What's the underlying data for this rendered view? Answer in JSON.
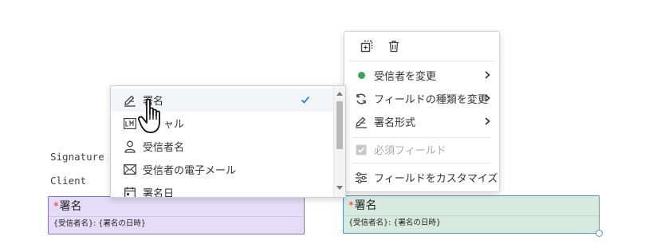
{
  "document": {
    "labels": [
      "Signature",
      "Client"
    ]
  },
  "fields": {
    "left": {
      "required_mark": "*",
      "title": "署名",
      "subtitle": "{受信者名}: {署名の日時}"
    },
    "right": {
      "required_mark": "*",
      "title": "署名",
      "subtitle": "{受信者名}: {署名の日時}"
    }
  },
  "context_menu": {
    "toolbar": [
      "copy-icon",
      "trash-icon"
    ],
    "items": [
      {
        "label": "受信者を変更",
        "icon": "green-dot-icon",
        "submenu": true,
        "disabled": false
      },
      {
        "label": "フィールドの種類を変更",
        "icon": "refresh-icon",
        "submenu": true,
        "disabled": false
      },
      {
        "label": "署名形式",
        "icon": "signature-icon",
        "submenu": true,
        "disabled": false
      },
      {
        "label": "必須フィールド",
        "icon": "checkbox-icon",
        "submenu": false,
        "disabled": true
      },
      {
        "label": "フィールドをカスタマイズ",
        "icon": "sliders-icon",
        "submenu": false,
        "disabled": false
      }
    ]
  },
  "field_type_dropdown": {
    "items": [
      {
        "label": "署名",
        "icon": "signature-icon",
        "selected": true
      },
      {
        "label": "ャル",
        "icon": "initials-icon",
        "selected": false
      },
      {
        "label": "受信者名",
        "icon": "person-icon",
        "selected": false
      },
      {
        "label": "受信者の電子メール",
        "icon": "envelope-icon",
        "selected": false
      },
      {
        "label": "署名日",
        "icon": "calendar-icon",
        "selected": false
      }
    ]
  },
  "colors": {
    "purple_field_bg": "#e6dcf8",
    "green_field_bg": "#d7eadf",
    "check_blue": "#2a7bd4",
    "dot_green": "#3ba55c"
  }
}
